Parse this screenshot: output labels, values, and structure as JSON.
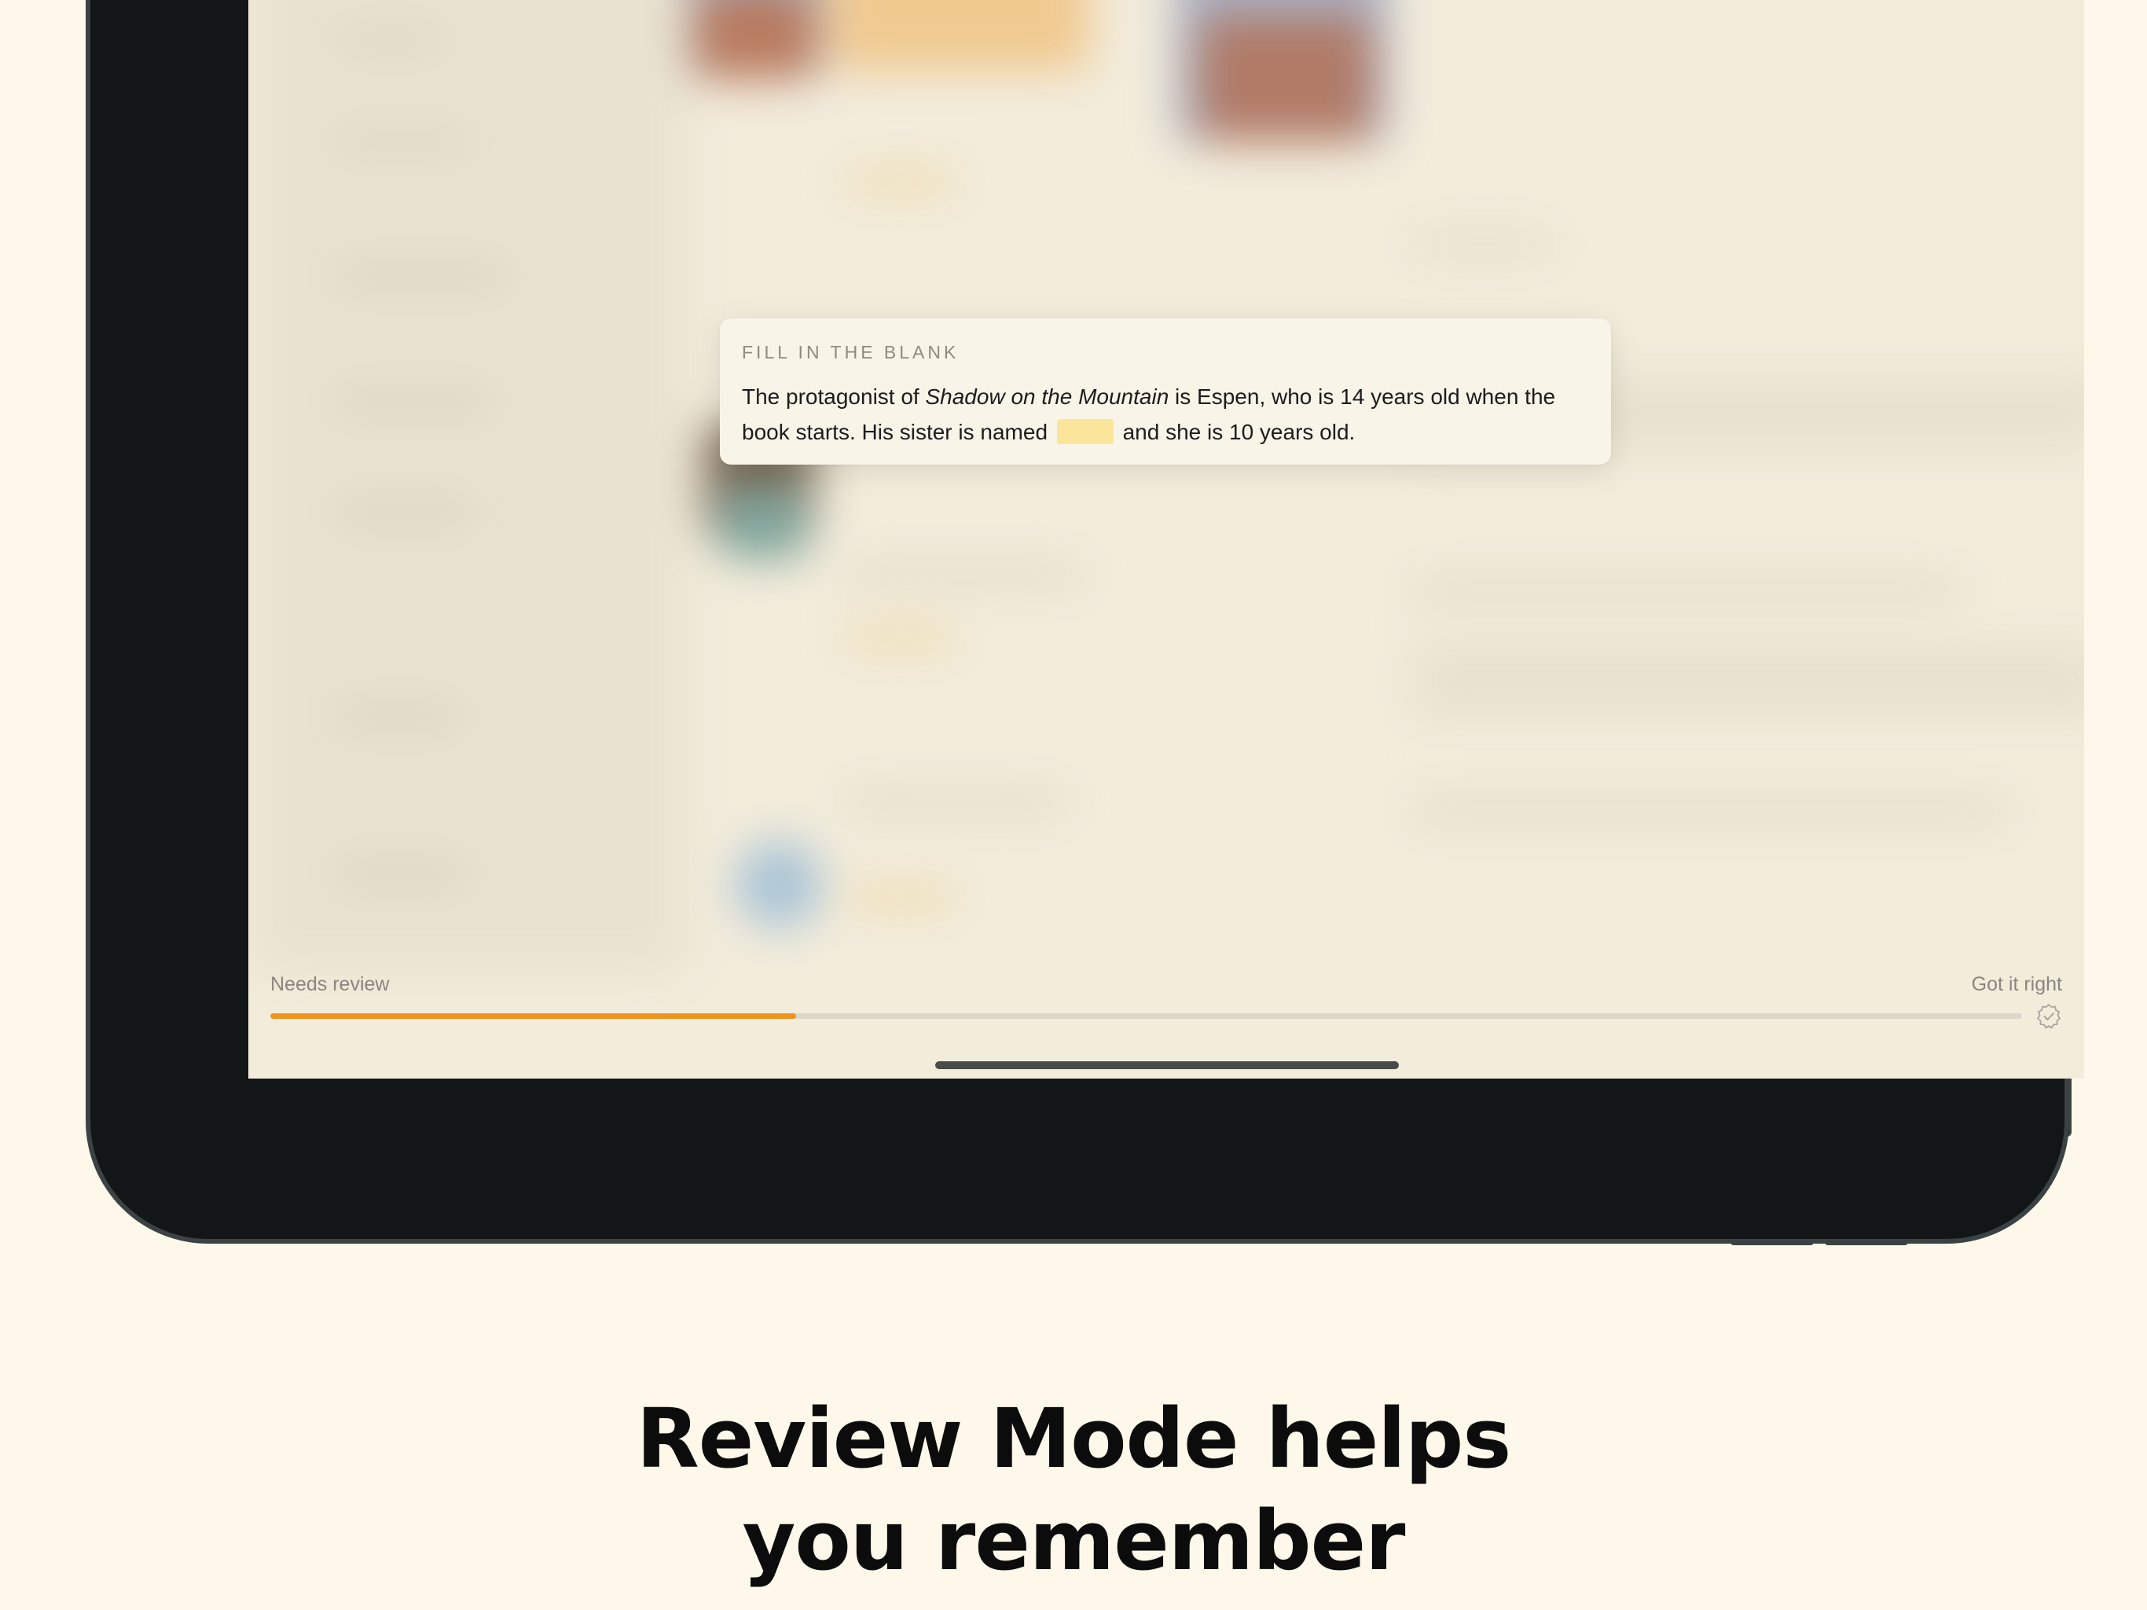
{
  "quiz": {
    "label": "FILL IN THE BLANK",
    "text_before_title": "The protagonist of ",
    "book_title": "Shadow on the Mountain",
    "text_middle": " is Espen, who is 14 years old when the book starts. His sister is named ",
    "text_after_blank": " and she is 10 years old."
  },
  "progress": {
    "left_label": "Needs review",
    "right_label": "Got it right",
    "fraction": 0.3,
    "fill_color": "#f0921c"
  },
  "headline": {
    "line1": "Review Mode helps",
    "line2": "you remember"
  },
  "icons": {
    "check_badge": "check-badge-icon"
  },
  "colors": {
    "background": "#fdf8ea",
    "blank_highlight": "#fbe59b",
    "device_frame": "#121617"
  }
}
